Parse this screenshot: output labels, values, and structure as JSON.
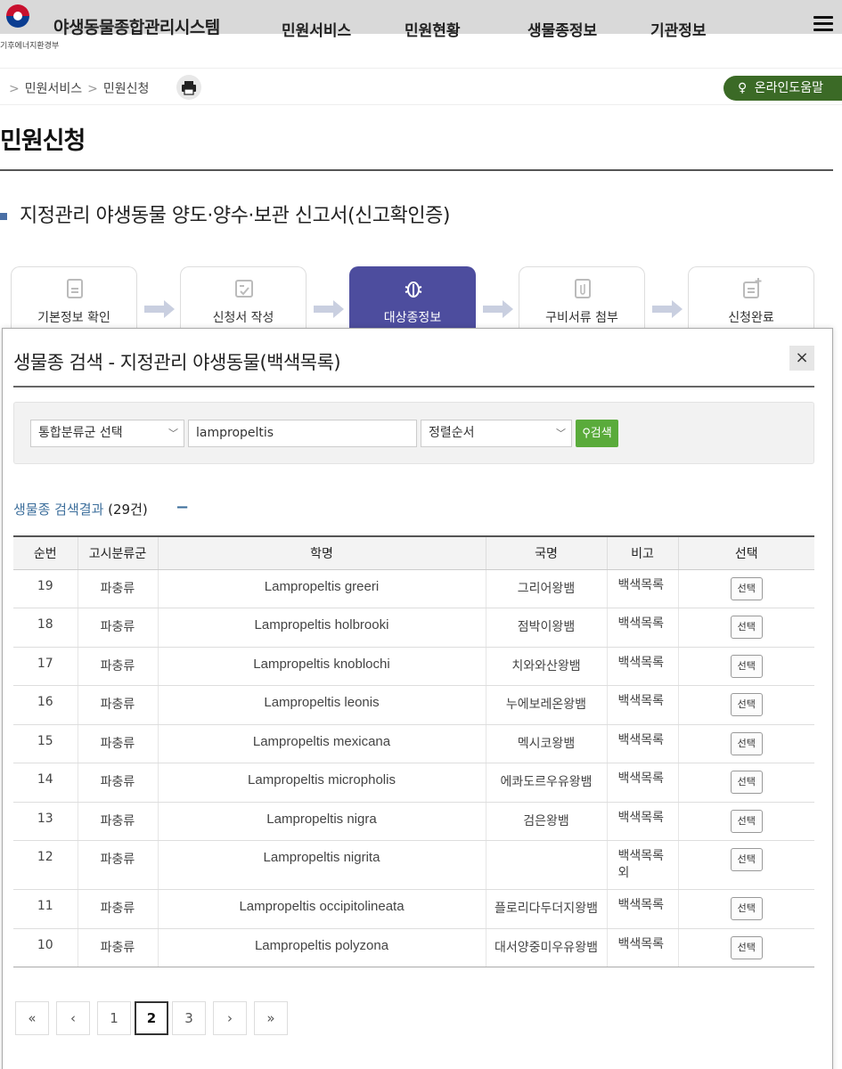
{
  "header": {
    "site_title": "야생동물종합관리시스템",
    "ministry": "기후에너지환경부",
    "nav": [
      "민원서비스",
      "민원현황",
      "생물종정보",
      "기관정보"
    ]
  },
  "breadcrumb": {
    "items": [
      "민원서비스",
      "민원신청"
    ],
    "help_label": "온라인도움말"
  },
  "page": {
    "title": "민원신청",
    "section_title": "지정관리 야생동물 양도·양수·보관 신고서(신고확인증)"
  },
  "steps": [
    {
      "label": "기본정보 확인",
      "icon": "document-icon",
      "active": false
    },
    {
      "label": "신청서 작성",
      "icon": "form-check-icon",
      "active": false
    },
    {
      "label": "대상종정보",
      "icon": "bug-icon",
      "active": true
    },
    {
      "label": "구비서류 첨부",
      "icon": "attachment-icon",
      "active": false
    },
    {
      "label": "신청완료",
      "icon": "document-add-icon",
      "active": false
    }
  ],
  "modal": {
    "title": "생물종 검색 - 지정관리 야생동물(백색목록)",
    "close_label": "×",
    "search": {
      "category_select": "통합분류군 선택",
      "keyword": "lampropeltis",
      "sort_select": "정렬순서",
      "button_label": "검색"
    },
    "result": {
      "label": "생물종 검색결과",
      "count": "(29건)",
      "toggle": "−"
    },
    "table": {
      "columns": [
        "순번",
        "고시분류군",
        "학명",
        "국명",
        "비고",
        "선택"
      ],
      "select_label": "선택",
      "rows": [
        {
          "no": "19",
          "group": "파충류",
          "sci": "Lampropeltis greeri",
          "kor": "그리어왕뱀",
          "note": "백색목록"
        },
        {
          "no": "18",
          "group": "파충류",
          "sci": "Lampropeltis holbrooki",
          "kor": "점박이왕뱀",
          "note": "백색목록"
        },
        {
          "no": "17",
          "group": "파충류",
          "sci": "Lampropeltis knoblochi",
          "kor": "치와와산왕뱀",
          "note": "백색목록"
        },
        {
          "no": "16",
          "group": "파충류",
          "sci": "Lampropeltis leonis",
          "kor": "누에보레온왕뱀",
          "note": "백색목록"
        },
        {
          "no": "15",
          "group": "파충류",
          "sci": "Lampropeltis mexicana",
          "kor": "멕시코왕뱀",
          "note": "백색목록"
        },
        {
          "no": "14",
          "group": "파충류",
          "sci": "Lampropeltis micropholis",
          "kor": "에콰도르우유왕뱀",
          "note": "백색목록"
        },
        {
          "no": "13",
          "group": "파충류",
          "sci": "Lampropeltis nigra",
          "kor": "검은왕뱀",
          "note": "백색목록"
        },
        {
          "no": "12",
          "group": "파충류",
          "sci": "Lampropeltis nigrita",
          "kor": "",
          "note": "백색목록 외"
        },
        {
          "no": "11",
          "group": "파충류",
          "sci": "Lampropeltis occipitolineata",
          "kor": "플로리다두더지왕뱀",
          "note": "백색목록"
        },
        {
          "no": "10",
          "group": "파충류",
          "sci": "Lampropeltis polyzona",
          "kor": "대서양중미우유왕뱀",
          "note": "백색목록"
        }
      ]
    },
    "pagination": {
      "first": "«",
      "prev": "‹",
      "pages": [
        "1",
        "2",
        "3"
      ],
      "current": "2",
      "next": "›",
      "last": "»"
    }
  },
  "colors": {
    "accent_step": "#4d4d9e",
    "search_button": "#5aab3b",
    "help_button": "#3b6a26",
    "result_title": "#3d6f9c"
  }
}
